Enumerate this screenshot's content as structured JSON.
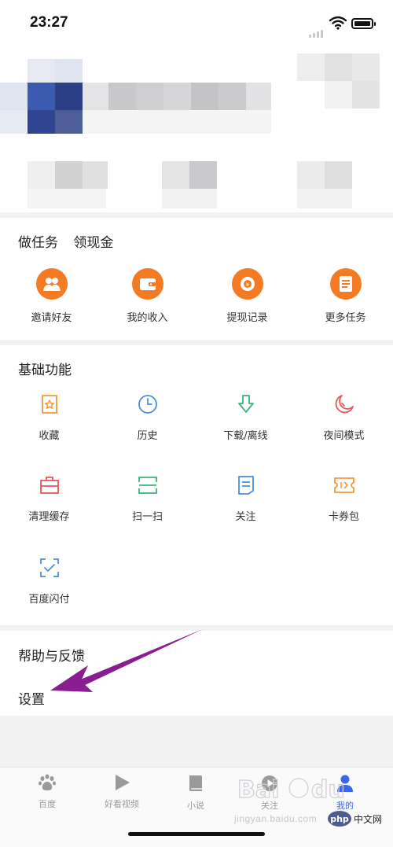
{
  "status_bar": {
    "time": "23:27"
  },
  "task_section": {
    "title_left": "做任务",
    "title_right": "领现金",
    "items": [
      {
        "label": "邀请好友",
        "icon": "invite-friends-icon"
      },
      {
        "label": "我的收入",
        "icon": "wallet-icon"
      },
      {
        "label": "提现记录",
        "icon": "withdraw-record-icon"
      },
      {
        "label": "更多任务",
        "icon": "task-list-icon"
      }
    ]
  },
  "basic_section": {
    "title": "基础功能",
    "items": [
      {
        "label": "收藏",
        "icon": "favorites-icon",
        "color": "#f39a3a"
      },
      {
        "label": "历史",
        "icon": "clock-icon",
        "color": "#4a8fe0"
      },
      {
        "label": "下载/离线",
        "icon": "download-icon",
        "color": "#3fb37a"
      },
      {
        "label": "夜间模式",
        "icon": "moon-icon",
        "color": "#e8555a"
      },
      {
        "label": "清理缓存",
        "icon": "clear-cache-icon",
        "color": "#e8555a"
      },
      {
        "label": "扫一扫",
        "icon": "scan-icon",
        "color": "#3fb37a"
      },
      {
        "label": "关注",
        "icon": "follow-icon",
        "color": "#4a8fe0"
      },
      {
        "label": "卡券包",
        "icon": "coupon-icon",
        "color": "#f39a3a"
      },
      {
        "label": "百度闪付",
        "icon": "quick-pay-icon",
        "color": "#4a8fe0"
      }
    ]
  },
  "help_section": {
    "help_label": "帮助与反馈",
    "settings_label": "设置"
  },
  "tab_bar": {
    "tabs": [
      {
        "label": "百度",
        "icon": "paw-icon"
      },
      {
        "label": "好看视频",
        "icon": "play-icon"
      },
      {
        "label": "小说",
        "icon": "book-icon"
      },
      {
        "label": "关注",
        "icon": "follow-play-icon"
      },
      {
        "label": "我的",
        "icon": "user-icon"
      }
    ],
    "active_index": 4
  },
  "watermark": {
    "url_text": "jingyan.baidu.com",
    "php_text": "php中文网"
  },
  "colors": {
    "accent_orange": "#f47a23",
    "active_tab": "#3b67e8",
    "annotation_arrow": "#8a1d8f"
  }
}
